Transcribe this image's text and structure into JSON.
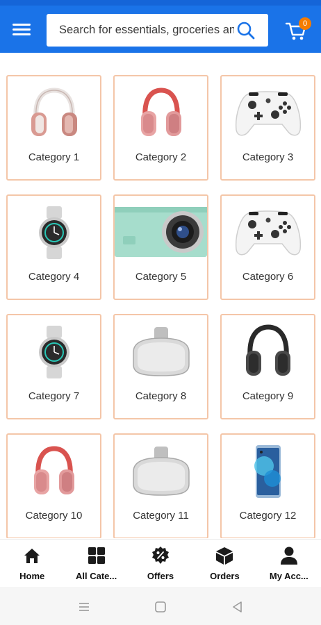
{
  "header": {
    "search_placeholder": "Search for essentials, groceries and more",
    "cart_count": "0"
  },
  "categories": [
    {
      "label": "Category 1",
      "icon": "headphones-rose-icon"
    },
    {
      "label": "Category 2",
      "icon": "headphones-pink-icon"
    },
    {
      "label": "Category 3",
      "icon": "game-controller-icon"
    },
    {
      "label": "Category 4",
      "icon": "smartwatch-icon"
    },
    {
      "label": "Category 5",
      "icon": "camera-icon"
    },
    {
      "label": "Category 6",
      "icon": "game-controller-icon"
    },
    {
      "label": "Category 7",
      "icon": "smartwatch-icon"
    },
    {
      "label": "Category 8",
      "icon": "vr-headset-icon"
    },
    {
      "label": "Category 9",
      "icon": "headphones-black-icon"
    },
    {
      "label": "Category 10",
      "icon": "headphones-pink-icon"
    },
    {
      "label": "Category 11",
      "icon": "vr-headset-icon"
    },
    {
      "label": "Category 12",
      "icon": "smartphone-icon"
    }
  ],
  "bottom_nav": [
    {
      "label": "Home",
      "icon": "home-icon"
    },
    {
      "label": "All Cate...",
      "icon": "grid-icon"
    },
    {
      "label": "Offers",
      "icon": "offer-icon"
    },
    {
      "label": "Orders",
      "icon": "box-icon"
    },
    {
      "label": "My Acc...",
      "icon": "user-icon"
    }
  ],
  "colors": {
    "header": "#1a73e8",
    "badge": "#f57c00",
    "card_border": "#f4c6a8"
  }
}
